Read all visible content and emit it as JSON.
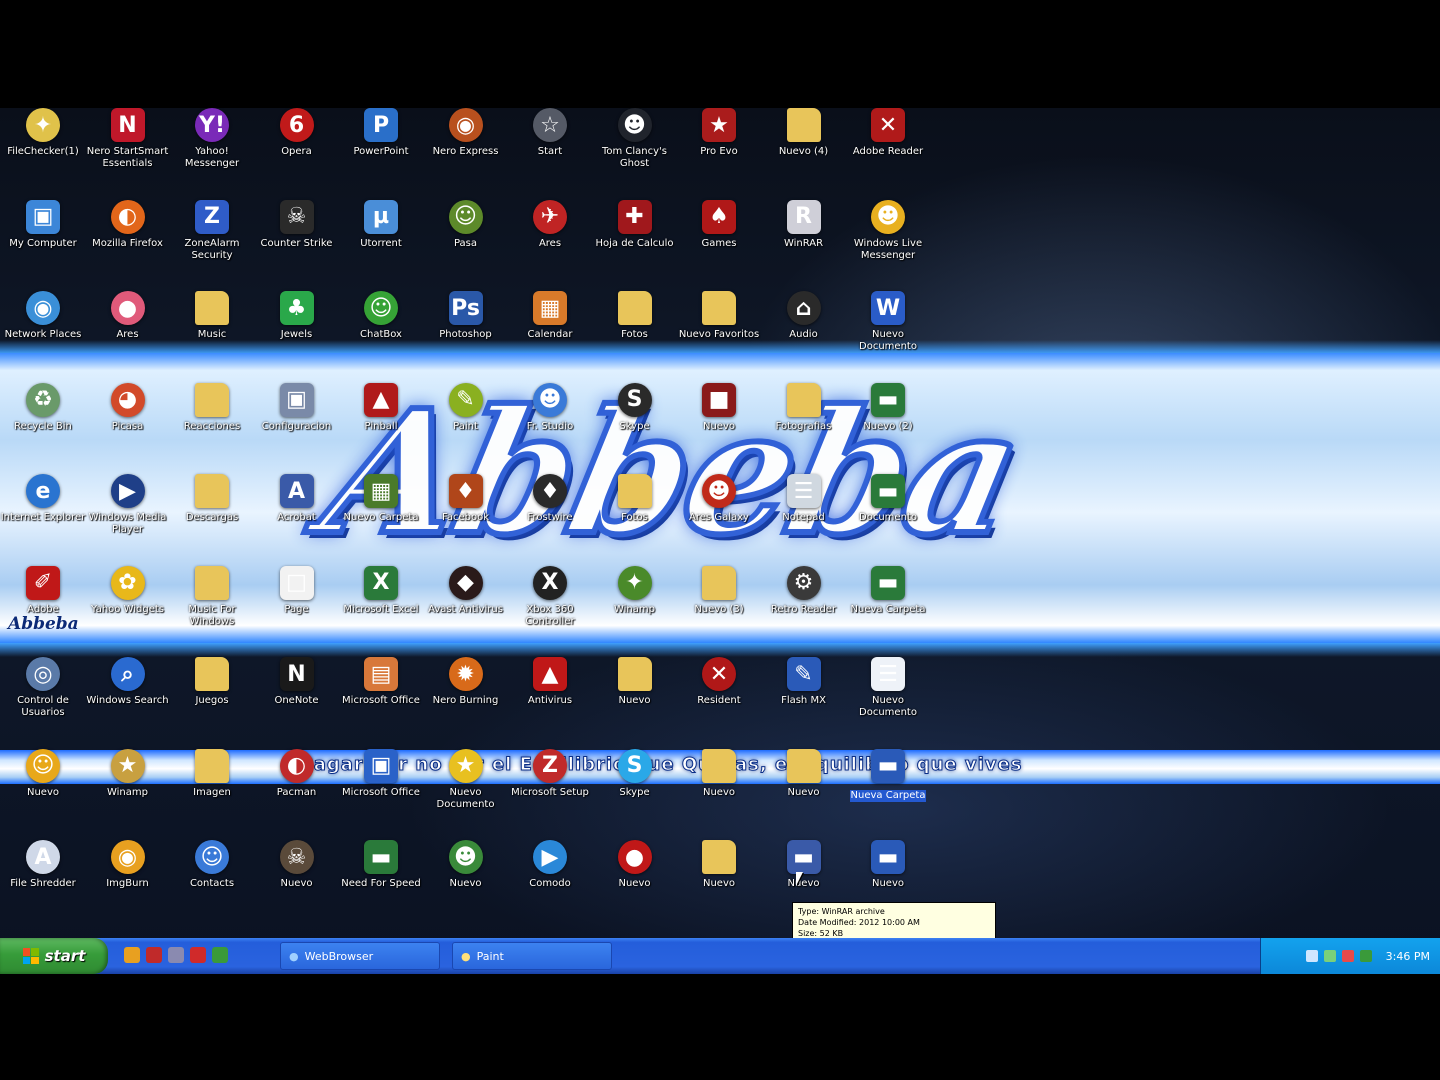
{
  "desktop": {
    "wallpaper_text": "Abbeba",
    "wall_signature": "Abbeba",
    "marquee_text": "Pagar por no ser el Equilibrio que Queras, el Equilibrio que vives"
  },
  "icons": [
    {
      "label": "FileChecker(1)",
      "glyph": "✦",
      "color": "#e0c24a",
      "shape": "round"
    },
    {
      "label": "Nero StartSmart Essentials",
      "glyph": "N",
      "color": "#c0182a",
      "shape": "box"
    },
    {
      "label": "Yahoo! Messenger",
      "glyph": "Y!",
      "color": "#7a2ab8",
      "shape": "round"
    },
    {
      "label": "Opera",
      "glyph": "6",
      "color": "#c01a1a",
      "shape": "round"
    },
    {
      "label": "PowerPoint",
      "glyph": "P",
      "color": "#2a6fc9",
      "shape": "box"
    },
    {
      "label": "Nero Express",
      "glyph": "◉",
      "color": "#b8501e",
      "shape": "round"
    },
    {
      "label": "Start",
      "glyph": "☆",
      "color": "#555a66",
      "shape": "round"
    },
    {
      "label": "Tom Clancy's Ghost",
      "glyph": "☻",
      "color": "#20242c",
      "shape": "round"
    },
    {
      "label": "Pro Evo",
      "glyph": "★",
      "color": "#aa1c1c",
      "shape": "box"
    },
    {
      "label": "Nuevo (4)",
      "glyph": "",
      "color": "#e8c55a",
      "shape": "folder"
    },
    {
      "label": "Adobe Reader",
      "glyph": "✕",
      "color": "#b01a1a",
      "shape": "box"
    },
    {
      "label": "My Computer",
      "glyph": "▣",
      "color": "#3c86d8",
      "shape": "box"
    },
    {
      "label": "Mozilla Firefox",
      "glyph": "◐",
      "color": "#e2661a",
      "shape": "round"
    },
    {
      "label": "ZoneAlarm Security",
      "glyph": "Z",
      "color": "#2f5cc8",
      "shape": "box"
    },
    {
      "label": "Counter Strike",
      "glyph": "☠",
      "color": "#2a2a2a",
      "shape": "box"
    },
    {
      "label": "Utorrent",
      "glyph": "µ",
      "color": "#4a8ed8",
      "shape": "box"
    },
    {
      "label": "Pasa",
      "glyph": "☺",
      "color": "#5d8a2a",
      "shape": "round"
    },
    {
      "label": "Ares",
      "glyph": "✈",
      "color": "#c02424",
      "shape": "round"
    },
    {
      "label": "Hoja de Calculo",
      "glyph": "✚",
      "color": "#a0181c",
      "shape": "box"
    },
    {
      "label": "Games",
      "glyph": "♠",
      "color": "#b01818",
      "shape": "box"
    },
    {
      "label": "WinRAR",
      "glyph": "R",
      "color": "#cfcfd8",
      "shape": "box"
    },
    {
      "label": "Windows Live Messenger",
      "glyph": "☻",
      "color": "#e8b020",
      "shape": "round"
    },
    {
      "label": "Network Places",
      "glyph": "◉",
      "color": "#3a8fd8",
      "shape": "round"
    },
    {
      "label": "Ares",
      "glyph": "●",
      "color": "#e05a7a",
      "shape": "round"
    },
    {
      "label": "Music",
      "glyph": "",
      "color": "#e8c55a",
      "shape": "folder"
    },
    {
      "label": "Jewels",
      "glyph": "♣",
      "color": "#2aa84a",
      "shape": "box"
    },
    {
      "label": "ChatBox",
      "glyph": "☺",
      "color": "#36a336",
      "shape": "round"
    },
    {
      "label": "Photoshop",
      "glyph": "Ps",
      "color": "#2a58a8",
      "shape": "box"
    },
    {
      "label": "Calendar",
      "glyph": "▦",
      "color": "#d87a2a",
      "shape": "box"
    },
    {
      "label": "Fotos",
      "glyph": "",
      "color": "#e8c55a",
      "shape": "folder"
    },
    {
      "label": "Nuevo Favoritos",
      "glyph": "",
      "color": "#e8c55a",
      "shape": "folder"
    },
    {
      "label": "Audio",
      "glyph": "⌂",
      "color": "#2a2a2a",
      "shape": "round"
    },
    {
      "label": "Nuevo Documento",
      "glyph": "W",
      "color": "#2a5cc8",
      "shape": "box"
    },
    {
      "label": "Recycle Bin",
      "glyph": "♻",
      "color": "#6a9a6a",
      "shape": "round"
    },
    {
      "label": "Picasa",
      "glyph": "◕",
      "color": "#d24a2a",
      "shape": "round"
    },
    {
      "label": "Reacciones",
      "glyph": "",
      "color": "#e8c55a",
      "shape": "folder"
    },
    {
      "label": "Configuracion",
      "glyph": "▣",
      "color": "#7a8aa8",
      "shape": "box"
    },
    {
      "label": "Pinball",
      "glyph": "▲",
      "color": "#b01a1a",
      "shape": "box"
    },
    {
      "label": "Paint",
      "glyph": "✎",
      "color": "#8ab020",
      "shape": "round"
    },
    {
      "label": "Fr. Studio",
      "glyph": "☻",
      "color": "#3a7ad8",
      "shape": "round"
    },
    {
      "label": "Skype",
      "glyph": "S",
      "color": "#2a2a2a",
      "shape": "round"
    },
    {
      "label": "Nuevo",
      "glyph": "■",
      "color": "#8a1a1a",
      "shape": "box"
    },
    {
      "label": "Fotografias",
      "glyph": "",
      "color": "#e8c55a",
      "shape": "folder"
    },
    {
      "label": "Nuevo (2)",
      "glyph": "▬",
      "color": "#2a7a3a",
      "shape": "box"
    },
    {
      "label": "Internet Explorer",
      "glyph": "e",
      "color": "#2a74d0",
      "shape": "round"
    },
    {
      "label": "Windows Media Player",
      "glyph": "▶",
      "color": "#1f3f88",
      "shape": "round"
    },
    {
      "label": "Descargas",
      "glyph": "",
      "color": "#e8c55a",
      "shape": "folder"
    },
    {
      "label": "Acrobat",
      "glyph": "A",
      "color": "#3a5aa8",
      "shape": "box"
    },
    {
      "label": "Nuevo Carpeta",
      "glyph": "▦",
      "color": "#4a7a2a",
      "shape": "box"
    },
    {
      "label": "Facebook",
      "glyph": "♦",
      "color": "#b0461a",
      "shape": "box"
    },
    {
      "label": "Frostwire",
      "glyph": "♦",
      "color": "#2a2a2a",
      "shape": "round"
    },
    {
      "label": "Fotos",
      "glyph": "",
      "color": "#e8c55a",
      "shape": "folder"
    },
    {
      "label": "Ares Galaxy",
      "glyph": "☻",
      "color": "#c02a1a",
      "shape": "round"
    },
    {
      "label": "Notepad",
      "glyph": "☰",
      "color": "#d0d8e0",
      "shape": "box"
    },
    {
      "label": "Documento",
      "glyph": "▬",
      "color": "#2a7a3a",
      "shape": "box"
    },
    {
      "label": "Adobe",
      "glyph": "✐",
      "color": "#c01818",
      "shape": "box"
    },
    {
      "label": "Yahoo Widgets",
      "glyph": "✿",
      "color": "#e8b81a",
      "shape": "round"
    },
    {
      "label": "Music For Windows",
      "glyph": "",
      "color": "#e8c55a",
      "shape": "folder"
    },
    {
      "label": "Page",
      "glyph": "□",
      "color": "#f2f2f2",
      "shape": "box"
    },
    {
      "label": "Microsoft Excel",
      "glyph": "X",
      "color": "#2a7a3a",
      "shape": "box"
    },
    {
      "label": "Avast Antivirus",
      "glyph": "◆",
      "color": "#2a1a1a",
      "shape": "round"
    },
    {
      "label": "Xbox 360 Controller",
      "glyph": "X",
      "color": "#222",
      "shape": "round"
    },
    {
      "label": "Winamp",
      "glyph": "✦",
      "color": "#4a8a2a",
      "shape": "round"
    },
    {
      "label": "Nuevo (3)",
      "glyph": "",
      "color": "#e8c55a",
      "shape": "folder"
    },
    {
      "label": "Retro Reader",
      "glyph": "⚙",
      "color": "#3a3a3a",
      "shape": "round"
    },
    {
      "label": "Nueva Carpeta",
      "glyph": "▬",
      "color": "#2a7a3a",
      "shape": "box"
    },
    {
      "label": "Control de Usuarios",
      "glyph": "◎",
      "color": "#5a7aa8",
      "shape": "round"
    },
    {
      "label": "Windows Search",
      "glyph": "⌕",
      "color": "#2a6ad0",
      "shape": "round"
    },
    {
      "label": "Juegos",
      "glyph": "",
      "color": "#e8c55a",
      "shape": "folder"
    },
    {
      "label": "OneNote",
      "glyph": "N",
      "color": "#1a1a1a",
      "shape": "box"
    },
    {
      "label": "Microsoft Office",
      "glyph": "▤",
      "color": "#d8783a",
      "shape": "box"
    },
    {
      "label": "Nero Burning",
      "glyph": "✹",
      "color": "#d86a1a",
      "shape": "round"
    },
    {
      "label": "Antivirus",
      "glyph": "▲",
      "color": "#c01818",
      "shape": "box"
    },
    {
      "label": "Nuevo",
      "glyph": "",
      "color": "#e8c55a",
      "shape": "folder"
    },
    {
      "label": "Resident",
      "glyph": "✕",
      "color": "#b01818",
      "shape": "round"
    },
    {
      "label": "Flash MX",
      "glyph": "✎",
      "color": "#2a5ab8",
      "shape": "box"
    },
    {
      "label": "Nuevo Documento",
      "glyph": "☰",
      "color": "#eef2f8",
      "shape": "box"
    },
    {
      "label": "Nuevo",
      "glyph": "☺",
      "color": "#e8a81a",
      "shape": "round"
    },
    {
      "label": "Winamp",
      "glyph": "★",
      "color": "#c8a040",
      "shape": "round"
    },
    {
      "label": "Imagen",
      "glyph": "",
      "color": "#e8c55a",
      "shape": "folder"
    },
    {
      "label": "Pacman",
      "glyph": "◐",
      "color": "#c02a2a",
      "shape": "round"
    },
    {
      "label": "Microsoft Office",
      "glyph": "▣",
      "color": "#2a62c8",
      "shape": "box"
    },
    {
      "label": "Nuevo Documento",
      "glyph": "★",
      "color": "#e8c020",
      "shape": "round"
    },
    {
      "label": "Microsoft Setup",
      "glyph": "Z",
      "color": "#c02a2a",
      "shape": "round"
    },
    {
      "label": "Skype",
      "glyph": "S",
      "color": "#2aa8e8",
      "shape": "round"
    },
    {
      "label": "Nuevo",
      "glyph": "",
      "color": "#e8c55a",
      "shape": "folder"
    },
    {
      "label": "Nuevo",
      "glyph": "",
      "color": "#e8c55a",
      "shape": "folder"
    },
    {
      "label": "Nueva Carpeta",
      "glyph": "▬",
      "color": "#2a5ab8",
      "shape": "box",
      "selected": true
    },
    {
      "label": "File Shredder",
      "glyph": "A",
      "color": "#cfd8e8",
      "shape": "round"
    },
    {
      "label": "ImgBurn",
      "glyph": "◉",
      "color": "#e8a020",
      "shape": "round"
    },
    {
      "label": "Contacts",
      "glyph": "☺",
      "color": "#3a7ad8",
      "shape": "round"
    },
    {
      "label": "Nuevo",
      "glyph": "☠",
      "color": "#5a4a3a",
      "shape": "round"
    },
    {
      "label": "Need For Speed",
      "glyph": "▬",
      "color": "#2a7a3a",
      "shape": "box"
    },
    {
      "label": "Nuevo",
      "glyph": "☻",
      "color": "#3a8a3a",
      "shape": "round"
    },
    {
      "label": "Comodo",
      "glyph": "▶",
      "color": "#2a88d8",
      "shape": "round"
    },
    {
      "label": "Nuevo",
      "glyph": "●",
      "color": "#c01818",
      "shape": "round"
    },
    {
      "label": "Nuevo",
      "glyph": "",
      "color": "#e8c55a",
      "shape": "folder"
    },
    {
      "label": "Nuevo",
      "glyph": "▬",
      "color": "#3a5aa8",
      "shape": "box"
    },
    {
      "label": "Nuevo",
      "glyph": "▬",
      "color": "#2a5ab8",
      "shape": "box"
    }
  ],
  "tooltip": {
    "type_line": "Type: WinRAR archive",
    "modified_line": "Date Modified: 2012 10:00 AM",
    "size_line": "Size: 52 KB"
  },
  "taskbar": {
    "start_label": "start",
    "tasks": [
      {
        "label": "WebBrowser",
        "icon": "ie-icon"
      },
      {
        "label": "Paint",
        "icon": "paint-icon"
      }
    ],
    "clock": "3:46 PM"
  }
}
